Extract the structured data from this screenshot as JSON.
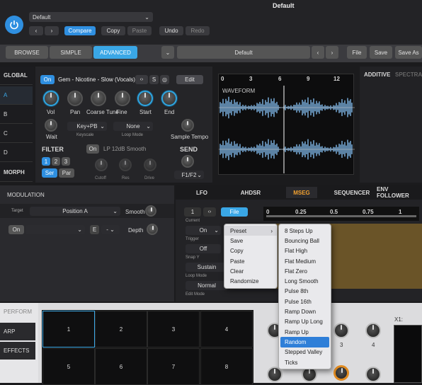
{
  "window": {
    "title": "Default"
  },
  "topbar": {
    "preset": "Default",
    "compare": "Compare",
    "copy": "Copy",
    "paste": "Paste",
    "undo": "Undo",
    "redo": "Redo"
  },
  "navbar": {
    "browse": "BROWSE",
    "simple": "SIMPLE",
    "advanced": "ADVANCED",
    "preset": "Default",
    "file": "File",
    "save": "Save",
    "save_as": "Save As"
  },
  "sidebar": {
    "global": "GLOBAL",
    "a": "A",
    "b": "B",
    "c": "C",
    "d": "D",
    "morph": "MORPH"
  },
  "sample": {
    "on": "On",
    "name": "Gem - Nicotine - Slow (Vocals)",
    "s": "S",
    "edit": "Edit",
    "knobs": [
      "Vol",
      "Pan",
      "Coarse Tune",
      "Fine",
      "Start",
      "End"
    ],
    "wait": "Wait",
    "keyscale_val": "Key+PB",
    "keyscale": "Keyscale",
    "loop_val": "None",
    "loop": "Loop Mode",
    "tempo": "Sample Tempo"
  },
  "filter": {
    "title": "FILTER",
    "on": "On",
    "type": "LP 12dB Smooth",
    "n1": "1",
    "n2": "2",
    "n3": "3",
    "ser": "Ser",
    "par": "Par",
    "cutoff": "Cutoff",
    "res": "Res",
    "drive": "Drive"
  },
  "send": {
    "title": "SEND",
    "value": "F1/F2"
  },
  "waveform": {
    "label": "WAVEFORM",
    "ticks": [
      "0",
      "3",
      "6",
      "9",
      "12"
    ]
  },
  "right_tabs": {
    "additive": "ADDITIVE",
    "spectral": "SPECTRA"
  },
  "modulation": {
    "title": "MODULATION",
    "target_label": "Target",
    "target_val": "Position A",
    "smooth": "Smooth",
    "on": "On",
    "e": "E",
    "depth": "Depth"
  },
  "mod_tabs": [
    "LFO",
    "AHDSR",
    "MSEG",
    "SEQUENCER",
    "ENV FOLLOWER"
  ],
  "mseg": {
    "sel": "1",
    "file": "File",
    "current": "Current",
    "on": "On",
    "trigger": "Trigger",
    "snap_val": "Off",
    "snap": "Snap Y",
    "sustain": "Sustain",
    "loop_mode": "Loop Mode",
    "normal": "Normal",
    "edit_mode": "Edit Mode",
    "ruler": [
      "0",
      "0.25",
      "0.5",
      "0.75",
      "1"
    ]
  },
  "context_menu": [
    "Preset",
    "Save",
    "Copy",
    "Paste",
    "Clear",
    "Randomize"
  ],
  "submenu": [
    "8 Steps Up",
    "Bouncing Ball",
    "Flat High",
    "Flat Medium",
    "Flat Zero",
    "Long Smooth",
    "Pulse 8th",
    "Pulse 16th",
    "Ramp Down",
    "Ramp Up Long",
    "Ramp Up",
    "Random",
    "Stepped Valley",
    "Ticks"
  ],
  "submenu_selected": 11,
  "perform": {
    "title": "PERFORM",
    "arp": "ARP",
    "effects": "EFFECTS",
    "pads": [
      "1",
      "2",
      "3",
      "4",
      "5",
      "6",
      "7",
      "8"
    ],
    "macros": [
      "3",
      "4"
    ],
    "x1": "X1:"
  }
}
